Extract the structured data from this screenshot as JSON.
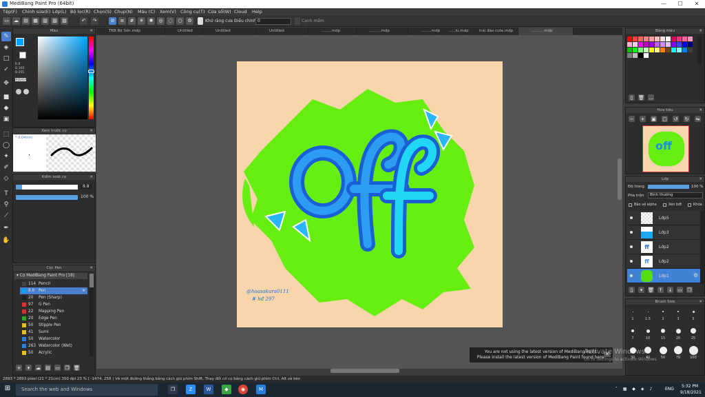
{
  "window": {
    "title": "MediBang Paint Pro (64bit)",
    "min": "—",
    "max": "☐",
    "close": "✕"
  },
  "menu": [
    "Tệp(F)",
    "Chỉnh sửa(E)",
    "Lớp(L)",
    "Bộ lọc(R)",
    "Chọn(S)",
    "Chụp(N)",
    "Màu (C)",
    "Xem(V)",
    "Công cụ(T)",
    "Cửa sổ(W)",
    "Cloud",
    "Help"
  ],
  "toolbar": {
    "antialias": "Khử răng cưa",
    "correction_label": "Điều chỉnh",
    "correction_value": "0",
    "snap": "Cạnh mềm"
  },
  "doc_tabs": [
    "TKB Bộ Sớn.mdp",
    "Untitled",
    "Untitled",
    "Untitled",
    ".........mdp",
    "..........mdp",
    ".........mdp",
    "......lu.mdp",
    "trái đào cute.mdp",
    "...........mdp"
  ],
  "color_panel": {
    "title": "Màu",
    "r": "R 0",
    "g": "G 165",
    "b": "B 255",
    "hex": "#00A5FF"
  },
  "brush_preview": {
    "title": "Xem trước cọ",
    "size": "* 0.04mm"
  },
  "brush_control": {
    "title": "Kiểm soát cọ",
    "size_value": "8.8",
    "opacity_value": "100 %"
  },
  "brush_panel": {
    "title": "Cọc Pen",
    "group": "Cọ MediBang Paint Pro [18]",
    "items": [
      {
        "num": "114",
        "name": "Pencil",
        "color": "#444444"
      },
      {
        "num": "8.8",
        "name": "Pen",
        "color": "#00A5FF"
      },
      {
        "num": "20",
        "name": "Pen (Sharp)",
        "color": "#222222"
      },
      {
        "num": "97",
        "name": "G Pen",
        "color": "#e03030"
      },
      {
        "num": "22",
        "name": "Mapping Pen",
        "color": "#d03030"
      },
      {
        "num": "20",
        "name": "Edge Pen",
        "color": "#2fa32f"
      },
      {
        "num": "50",
        "name": "Stipple Pen",
        "color": "#e6c020"
      },
      {
        "num": "41",
        "name": "Sumi",
        "color": "#e6c020"
      },
      {
        "num": "50",
        "name": "Watercolor",
        "color": "#2d7fd9"
      },
      {
        "num": "263",
        "name": "Watercolor (Wet)",
        "color": "#2d7fd9"
      },
      {
        "num": "50",
        "name": "Acrylic",
        "color": "#e6c020"
      }
    ]
  },
  "swatch_panel": {
    "title": "Bảng màu"
  },
  "navigator": {
    "title": "Hoa tiêu"
  },
  "layer_panel": {
    "title": "Lớp",
    "opacity_label": "Độ trong",
    "opacity_value": "100 %",
    "blend_label": "Pha trộn",
    "blend_value": "Bình thường",
    "protect_alpha": "Bảo vệ alpha",
    "clipping": "Xén bớt",
    "lock": "Khóa",
    "layers": [
      {
        "name": "Lớp5",
        "thumb": "#eeeeee"
      },
      {
        "name": "Lớp3",
        "thumb": "#1ea8ef"
      },
      {
        "name": "Lớp2",
        "thumb": "#1767d0"
      },
      {
        "name": "Lớp2",
        "thumb": "#3b8de0"
      },
      {
        "name": "Lớp1",
        "thumb": "#55dd10"
      }
    ]
  },
  "brush_size": {
    "title": "Brush Size",
    "labels": [
      "1",
      "1.5",
      "2",
      "3",
      "5",
      "7",
      "10",
      "15",
      "20",
      "25",
      "30",
      "40",
      "50",
      "70",
      "100"
    ]
  },
  "artwork": {
    "text": "off",
    "signature": "@hoasakura0111",
    "tag": "# hđ 297"
  },
  "status": "2893 * 2893 pixel  (21 * 21cm)  350 dpi  23 %  ( -1474, 258 )  Vẽ một đường thẳng bằng cách giữ phím Shift, Thay đổi cỡ cọ bằng cách giữ phím Ctrl, Alt và kéo",
  "notice": {
    "line1": "You are not using the latest version of MediBang Paint.",
    "line2": "Please install the latest version of MediBang Paint found here."
  },
  "watermark": {
    "line1": "Activate Windows",
    "line2": "Go to Settings to activate Windows."
  },
  "taskbar": {
    "search": "Search the web and Windows",
    "time": "5:32 PM",
    "date": "9/18/2021",
    "lang": "ENG"
  }
}
